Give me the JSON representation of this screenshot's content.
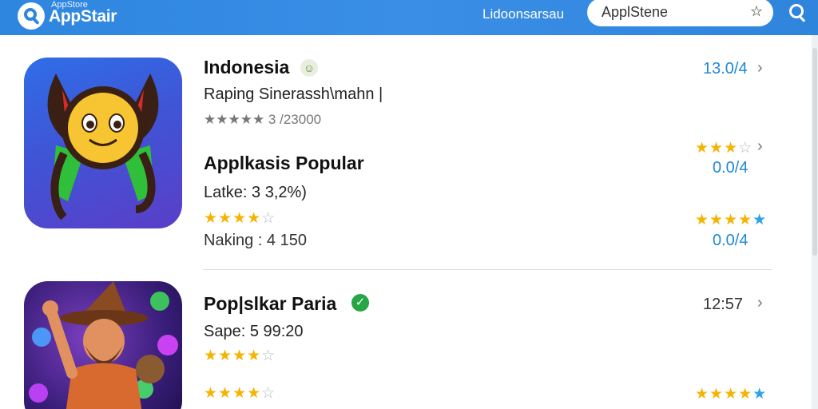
{
  "header": {
    "brand_small": "AppStore",
    "brand": "AppStair",
    "lang_link": "Lidoonsarsau",
    "search_value": "ApplStene",
    "logo_icon": "search-icon",
    "accent_color": "#2e86de"
  },
  "apps": [
    {
      "title": "Indonesia",
      "subtitle": "Raping Sinerassh\\mahn |",
      "rating_text": "★★★★★ 3 /23000",
      "section": "Applkasis Popular",
      "latest": "Latke: 3 3,2%)",
      "naking": "Naking : 4 150",
      "price_top": "13.0/4",
      "value_mid": "0.0/4",
      "value_low": "0.0/4"
    },
    {
      "title": "Pop|slkar Paria",
      "sape": "Sape: 5 99:20",
      "time": "12:57"
    }
  ],
  "colors": {
    "star_gold": "#f5b400",
    "star_blue": "#2aa4e8",
    "value_blue": "#1f88d6",
    "verified_green": "#26a644"
  }
}
